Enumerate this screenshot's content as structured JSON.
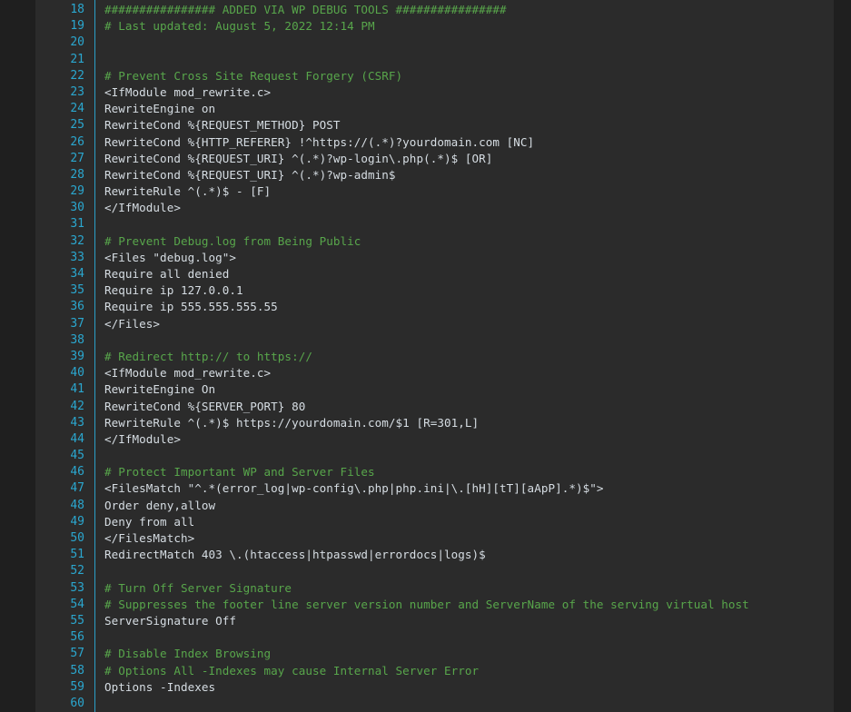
{
  "editor": {
    "language": "apache-htaccess",
    "colors": {
      "background": "#2b2b2b",
      "outer_background": "#1f1f1f",
      "line_number": "#2ba7cf",
      "gutter_divider": "#2ba0c8",
      "code_text": "#d6dde3",
      "comment_text": "#58a64b"
    },
    "lines": [
      {
        "number": "18",
        "text": "################ ADDED VIA WP DEBUG TOOLS ################",
        "type": "comment"
      },
      {
        "number": "19",
        "text": "# Last updated: August 5, 2022 12:14 PM",
        "type": "comment"
      },
      {
        "number": "20",
        "text": "",
        "type": "code"
      },
      {
        "number": "21",
        "text": "",
        "type": "code"
      },
      {
        "number": "22",
        "text": "# Prevent Cross Site Request Forgery (CSRF)",
        "type": "comment"
      },
      {
        "number": "23",
        "text": "<IfModule mod_rewrite.c>",
        "type": "code"
      },
      {
        "number": "24",
        "text": "RewriteEngine on",
        "type": "code"
      },
      {
        "number": "25",
        "text": "RewriteCond %{REQUEST_METHOD} POST",
        "type": "code"
      },
      {
        "number": "26",
        "text": "RewriteCond %{HTTP_REFERER} !^https://(.*)?yourdomain.com [NC]",
        "type": "code"
      },
      {
        "number": "27",
        "text": "RewriteCond %{REQUEST_URI} ^(.*)?wp-login\\.php(.*)$ [OR]",
        "type": "code"
      },
      {
        "number": "28",
        "text": "RewriteCond %{REQUEST_URI} ^(.*)?wp-admin$",
        "type": "code"
      },
      {
        "number": "29",
        "text": "RewriteRule ^(.*)$ - [F]",
        "type": "code"
      },
      {
        "number": "30",
        "text": "</IfModule>",
        "type": "code"
      },
      {
        "number": "31",
        "text": "",
        "type": "code"
      },
      {
        "number": "32",
        "text": "# Prevent Debug.log from Being Public",
        "type": "comment"
      },
      {
        "number": "33",
        "text": "<Files \"debug.log\">",
        "type": "code"
      },
      {
        "number": "34",
        "text": "Require all denied",
        "type": "code"
      },
      {
        "number": "35",
        "text": "Require ip 127.0.0.1",
        "type": "code"
      },
      {
        "number": "36",
        "text": "Require ip 555.555.555.55",
        "type": "code"
      },
      {
        "number": "37",
        "text": "</Files>",
        "type": "code"
      },
      {
        "number": "38",
        "text": "",
        "type": "code"
      },
      {
        "number": "39",
        "text": "# Redirect http:// to https://",
        "type": "comment"
      },
      {
        "number": "40",
        "text": "<IfModule mod_rewrite.c>",
        "type": "code"
      },
      {
        "number": "41",
        "text": "RewriteEngine On",
        "type": "code"
      },
      {
        "number": "42",
        "text": "RewriteCond %{SERVER_PORT} 80",
        "type": "code"
      },
      {
        "number": "43",
        "text": "RewriteRule ^(.*)$ https://yourdomain.com/$1 [R=301,L]",
        "type": "code"
      },
      {
        "number": "44",
        "text": "</IfModule>",
        "type": "code"
      },
      {
        "number": "45",
        "text": "",
        "type": "code"
      },
      {
        "number": "46",
        "text": "# Protect Important WP and Server Files",
        "type": "comment"
      },
      {
        "number": "47",
        "text": "<FilesMatch \"^.*(error_log|wp-config\\.php|php.ini|\\.[hH][tT][aApP].*)$\">",
        "type": "code"
      },
      {
        "number": "48",
        "text": "Order deny,allow",
        "type": "code"
      },
      {
        "number": "49",
        "text": "Deny from all",
        "type": "code"
      },
      {
        "number": "50",
        "text": "</FilesMatch>",
        "type": "code"
      },
      {
        "number": "51",
        "text": "RedirectMatch 403 \\.(htaccess|htpasswd|errordocs|logs)$",
        "type": "code"
      },
      {
        "number": "52",
        "text": "",
        "type": "code"
      },
      {
        "number": "53",
        "text": "# Turn Off Server Signature",
        "type": "comment"
      },
      {
        "number": "54",
        "text": "# Suppresses the footer line server version number and ServerName of the serving virtual host",
        "type": "comment"
      },
      {
        "number": "55",
        "text": "ServerSignature Off",
        "type": "code"
      },
      {
        "number": "56",
        "text": "",
        "type": "code"
      },
      {
        "number": "57",
        "text": "# Disable Index Browsing",
        "type": "comment"
      },
      {
        "number": "58",
        "text": "# Options All -Indexes may cause Internal Server Error",
        "type": "comment"
      },
      {
        "number": "59",
        "text": "Options -Indexes",
        "type": "code"
      },
      {
        "number": "60",
        "text": "",
        "type": "code"
      }
    ]
  }
}
